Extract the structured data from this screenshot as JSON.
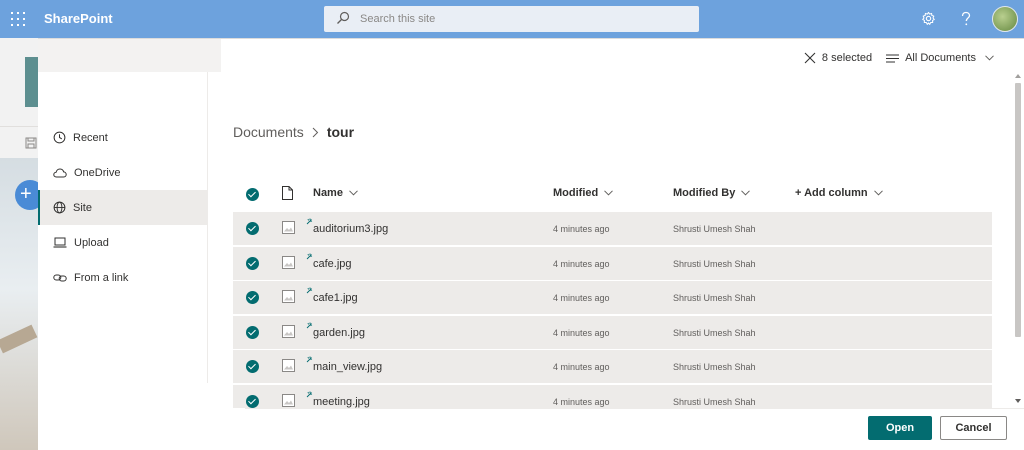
{
  "suite": {
    "brand": "SharePoint",
    "search_placeholder": "Search this site"
  },
  "nav": {
    "items": [
      {
        "label": "Recent",
        "icon": "clock-icon",
        "selected": false
      },
      {
        "label": "OneDrive",
        "icon": "cloud-icon",
        "selected": false
      },
      {
        "label": "Site",
        "icon": "globe-icon",
        "selected": true
      },
      {
        "label": "Upload",
        "icon": "laptop-icon",
        "selected": false
      },
      {
        "label": "From a link",
        "icon": "link-icon",
        "selected": false
      }
    ]
  },
  "commandbar": {
    "selected_label": "8 selected",
    "view_label": "All Documents"
  },
  "breadcrumb": {
    "parent": "Documents",
    "current": "tour"
  },
  "list": {
    "columns": {
      "name": "Name",
      "modified": "Modified",
      "modified_by": "Modified By",
      "add_column": "+ Add column"
    },
    "rows": [
      {
        "name": "auditorium3.jpg",
        "modified": "4 minutes ago",
        "modified_by": "Shrusti Umesh Shah"
      },
      {
        "name": "cafe.jpg",
        "modified": "4 minutes ago",
        "modified_by": "Shrusti Umesh Shah"
      },
      {
        "name": "cafe1.jpg",
        "modified": "4 minutes ago",
        "modified_by": "Shrusti Umesh Shah"
      },
      {
        "name": "garden.jpg",
        "modified": "4 minutes ago",
        "modified_by": "Shrusti Umesh Shah"
      },
      {
        "name": "main_view.jpg",
        "modified": "4 minutes ago",
        "modified_by": "Shrusti Umesh Shah"
      },
      {
        "name": "meeting.jpg",
        "modified": "4 minutes ago",
        "modified_by": "Shrusti Umesh Shah"
      }
    ]
  },
  "footer": {
    "open_label": "Open",
    "cancel_label": "Cancel"
  },
  "colors": {
    "suite_bar": "#6da2dd",
    "accent": "#036c70",
    "selected_row": "#edebe9"
  }
}
